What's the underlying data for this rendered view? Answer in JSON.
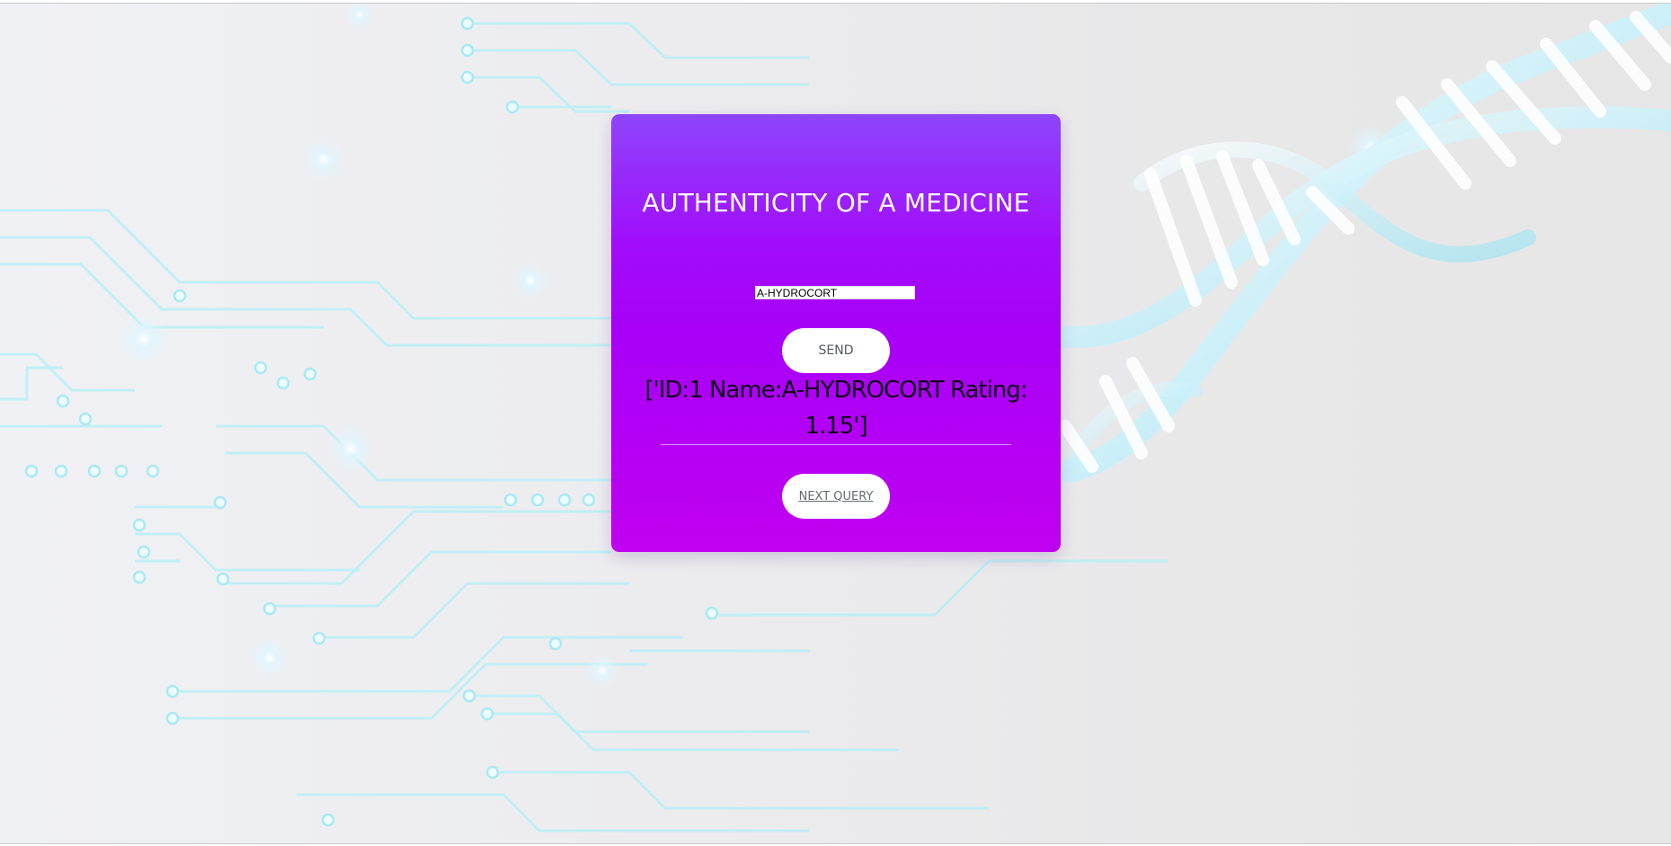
{
  "form": {
    "title": "AUTHENTICITY OF A MEDICINE",
    "medicine_input_value": "A-HYDROCORT",
    "send_label": "SEND",
    "result_text": "['ID:1 Name:A-HYDROCORT Rating: 1.15']",
    "next_query_label": "NEXT QUERY"
  },
  "colors": {
    "card_gradient_top": "#8e45fb",
    "card_gradient_bottom": "#c100f0",
    "button_background": "#ffffff",
    "title_text": "#ffffff",
    "result_text": "#0f0018"
  },
  "background": {
    "icons": [
      "circuit-board-graphic",
      "dna-helix-graphic"
    ]
  }
}
